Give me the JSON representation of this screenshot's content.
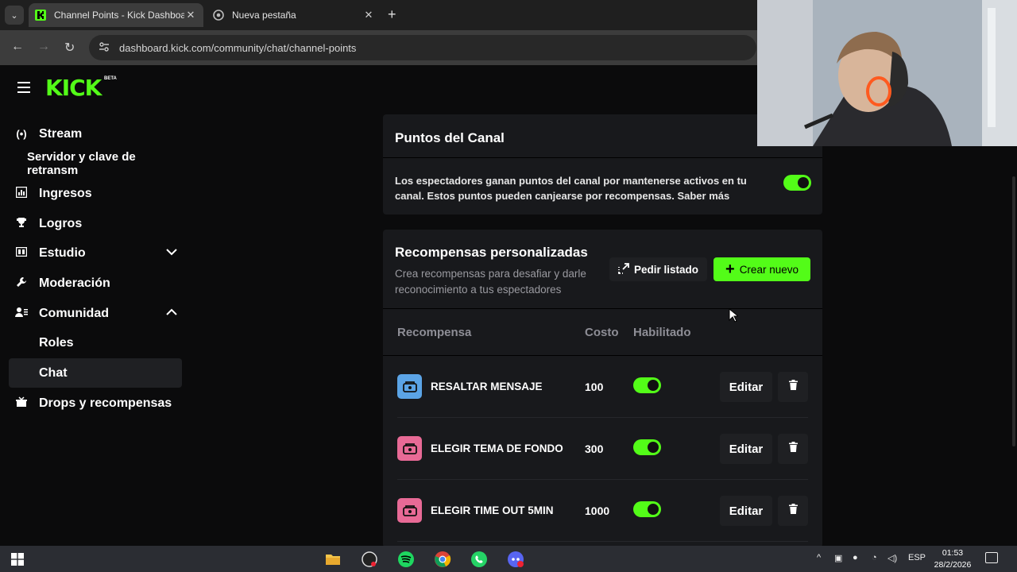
{
  "browser": {
    "tabs": [
      {
        "title": "Channel Points - Kick Dashboar",
        "active": true
      },
      {
        "title": "Nueva pestaña",
        "active": false
      }
    ],
    "url": "dashboard.kick.com/community/chat/channel-points"
  },
  "brand": {
    "logo": "KICK",
    "badge": "BETA",
    "accent": "#53fc18"
  },
  "sidebar": {
    "items": [
      {
        "label": "Stream",
        "icon": "broadcast-icon"
      },
      {
        "label": "Servidor y clave de retransm",
        "icon": "none"
      },
      {
        "label": "Ingresos",
        "icon": "chart-icon"
      },
      {
        "label": "Logros",
        "icon": "trophy-icon"
      },
      {
        "label": "Estudio",
        "icon": "studio-icon",
        "chevron": "down"
      },
      {
        "label": "Moderación",
        "icon": "wrench-icon"
      },
      {
        "label": "Comunidad",
        "icon": "users-icon",
        "chevron": "up"
      },
      {
        "label": "Roles",
        "icon": "none"
      },
      {
        "label": "Chat",
        "icon": "none",
        "active": true
      },
      {
        "label": "Drops y recompensas",
        "icon": "gift-icon"
      }
    ]
  },
  "points": {
    "title": "Puntos del Canal",
    "description": "Los espectadores ganan puntos del canal por mantenerse activos en tu canal. Estos puntos pueden canjearse por recompensas. Saber más",
    "enabled": true
  },
  "rewards": {
    "title": "Recompensas personalizadas",
    "subtitle": "Crea recompensas para desafiar y darle reconocimiento a tus espectadores",
    "request_label": "Pedir listado",
    "create_label": "Crear nuevo",
    "headers": {
      "reward": "Recompensa",
      "cost": "Costo",
      "enabled": "Habilitado"
    },
    "rows": [
      {
        "name": "RESALTAR MENSAJE",
        "cost": "100",
        "enabled": true,
        "color": "#5ba4e6",
        "edit": "Editar"
      },
      {
        "name": "ELEGIR TEMA DE FONDO",
        "cost": "300",
        "enabled": true,
        "color": "#e86a96",
        "edit": "Editar"
      },
      {
        "name": "ELEGIR TIME OUT 5MIN",
        "cost": "1000",
        "enabled": true,
        "color": "#e86a96",
        "edit": "Editar"
      }
    ]
  },
  "taskbar": {
    "lang": "ESP",
    "time": "01:53",
    "date": "28/2/2026"
  }
}
